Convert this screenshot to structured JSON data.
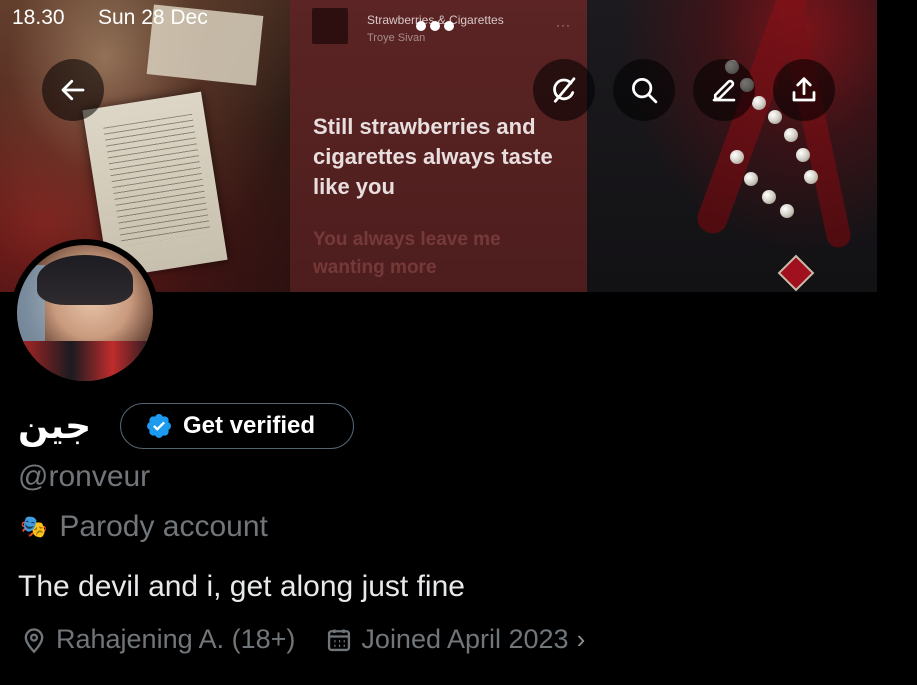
{
  "status_bar": {
    "time": "18.30",
    "date": "Sun 28 Dec"
  },
  "banner": {
    "song_title": "Strawberries & Cigarettes",
    "song_artist": "Troye Sivan",
    "song_more": "···",
    "lyric_current": "Still strawberries and cigarettes always taste like you",
    "lyric_next": "You always leave me wanting more"
  },
  "header_actions": {
    "back": "back-arrow-icon",
    "grok": "grok-icon",
    "search": "search-icon",
    "edit": "edit-icon",
    "share": "share-icon"
  },
  "profile": {
    "display_name": "جين",
    "get_verified_label": "Get verified",
    "handle": "@ronveur",
    "parody_label": "Parody account",
    "bio": "The devil and i, get along just fine",
    "location": "Rahajening A. (18+)",
    "joined": "Joined April 2023",
    "joined_chevron": "›"
  },
  "colors": {
    "background": "#000000",
    "primary_text": "#e7e9ea",
    "secondary_text": "#71767b",
    "verified_blue": "#1d9bf0",
    "border": "#536471"
  }
}
